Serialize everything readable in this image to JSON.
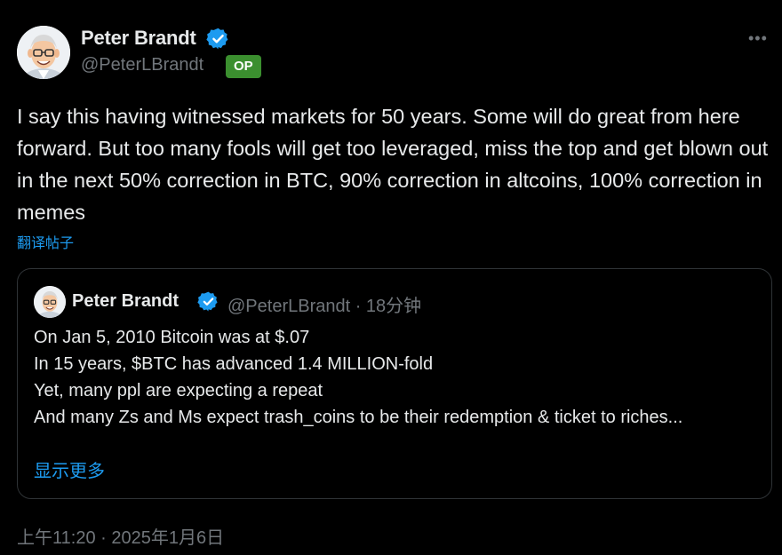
{
  "author": {
    "name": "Peter Brandt",
    "handle": "@PeterLBrandt",
    "badge": "OP",
    "avatar_icon": "cartoon-avatar",
    "verified_icon": "verified-badge-icon"
  },
  "menu": {
    "more_icon": "more-horizontal-icon",
    "glyph": "•••"
  },
  "tweet": {
    "text": "I say this having witnessed markets for 50 years. Some will do great from here forward. But too many fools will get too leveraged, miss the top and get blown out in the next 50% correction in BTC, 90% correction in altcoins, 100% correction in memes",
    "translate_label": "翻译帖子",
    "timestamp": "上午11:20 · 2025年1月6日"
  },
  "quote": {
    "name": "Peter Brandt",
    "meta": "@PeterLBrandt · 18分钟",
    "lines": [
      "On Jan 5, 2010 Bitcoin was at $.07",
      "In 15 years, $BTC has advanced 1.4 MILLION-fold",
      "Yet, many ppl are expecting a repeat",
      "And many Zs and Ms expect trash_coins to be their redemption & ticket to riches..."
    ],
    "show_more_label": "显示更多"
  },
  "colors": {
    "background": "#000000",
    "text": "#e7e9ea",
    "muted": "#71767b",
    "link": "#1d9bf0",
    "verified": "#1d9bf0",
    "op_badge": "#3b8f2f",
    "border": "#2f3336"
  }
}
